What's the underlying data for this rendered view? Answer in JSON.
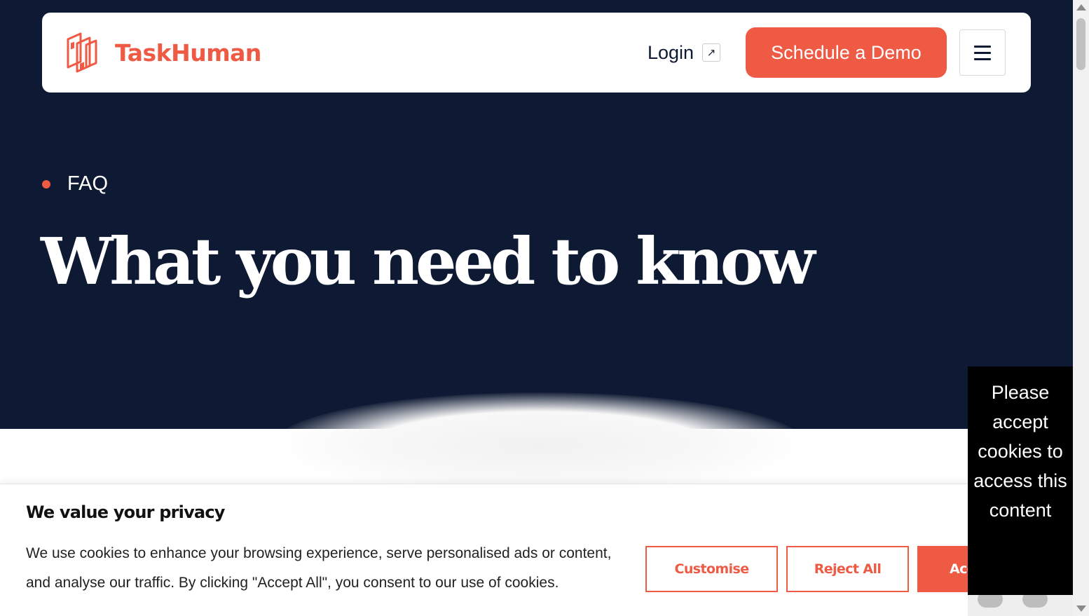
{
  "brand": {
    "name": "TaskHuman",
    "accent_color": "#ef5a45",
    "dark_color": "#0e1a33"
  },
  "nav": {
    "login_label": "Login",
    "login_icon": "arrow-up-right-icon",
    "demo_label": "Schedule a Demo",
    "menu_icon": "hamburger-menu-icon"
  },
  "hero": {
    "eyebrow": "FAQ",
    "headline": "What you need to know"
  },
  "cookie_banner": {
    "title": "We value your privacy",
    "body": "We use cookies to enhance your browsing experience, serve personalised ads or content, and analyse our traffic. By clicking \"Accept All\", you consent to our use of cookies.",
    "customise_label": "Customise",
    "reject_label": "Reject All",
    "accept_label": "Accept All"
  },
  "content_gate": {
    "message": "Please accept cookies to access this content"
  }
}
